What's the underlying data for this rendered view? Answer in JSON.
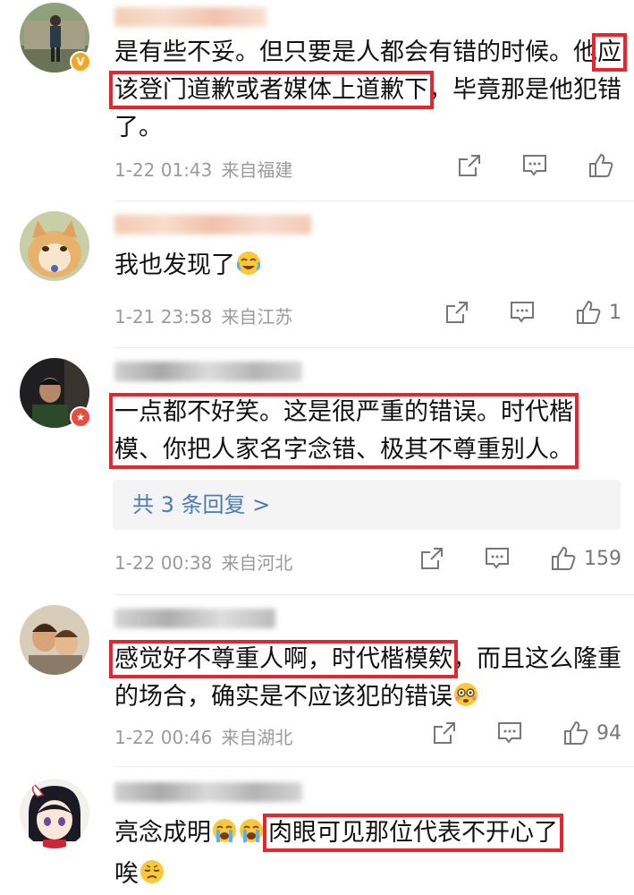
{
  "comments": [
    {
      "text_pre": "是有些不妥。但只要是人都会有错的时候。他",
      "text_hl": "应该登门道歉或者媒体上道歉下",
      "text_post": "，毕竟那是他犯错了。",
      "time": "1-22 01:43",
      "location": "来自福建",
      "likes": ""
    },
    {
      "text": "我也发现了",
      "emoji": "laughing-crying-emoji",
      "time": "1-21 23:58",
      "location": "来自江苏",
      "likes": "1"
    },
    {
      "text_hl": "一点都不好笑。这是很严重的错误。时代楷模、你把人家名字念错、极其不尊重别人。",
      "replies": "共 3 条回复 >",
      "time": "1-22 00:38",
      "location": "来自河北",
      "likes": "159"
    },
    {
      "text_hl": "感觉好不尊重人啊，时代楷模欸",
      "text_post": "，而且这么隆重的场合，确实是不应该犯的错误",
      "emoji": "flushed-emoji",
      "time": "1-22 00:46",
      "location": "来自湖北",
      "likes": "94"
    },
    {
      "text_pre": "亮念成明",
      "emoji": "crying-emoji",
      "text_hl": "肉眼可见那位代表不开心了",
      "text_post": "唉",
      "emoji2": "sad-emoji"
    }
  ],
  "colors": {
    "highlight": "#e8242f",
    "reply_link": "#4a7ab8",
    "meta": "#9a9a9a"
  }
}
